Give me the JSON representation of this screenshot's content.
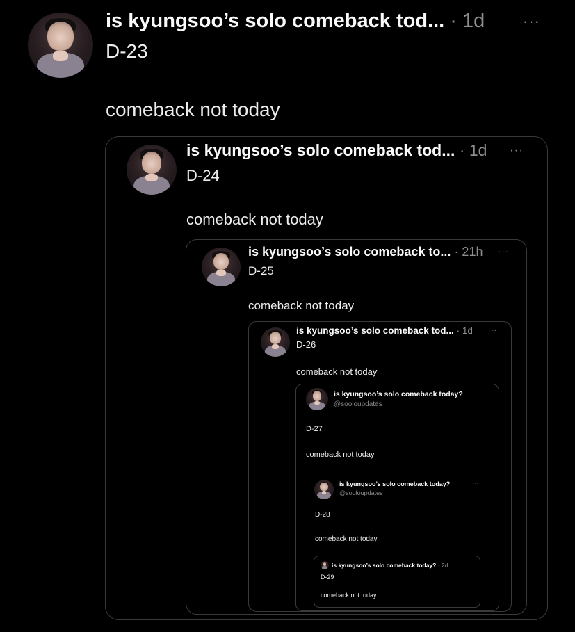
{
  "posts": [
    {
      "title": "is kyungsoo’s solo comeback tod...",
      "time": "· 1d",
      "dday": "D-23",
      "body": "comeback not today"
    },
    {
      "title": "is kyungsoo’s solo comeback tod...",
      "time": "· 1d",
      "dday": "D-24",
      "body": "comeback not today"
    },
    {
      "title": "is kyungsoo’s solo comeback to...",
      "time": "· 21h",
      "dday": "D-25",
      "body": "comeback not today"
    },
    {
      "title": "is kyungsoo’s solo comeback tod...",
      "time": "· 1d",
      "dday": "D-26",
      "body": "comeback not today"
    },
    {
      "title": "is kyungsoo’s solo comeback today?",
      "handle": "@sooloupdates",
      "dday": "D-27",
      "body": "comeback not today"
    },
    {
      "title": "is kyungsoo’s solo comeback today?",
      "handle": "@sooloupdates",
      "dday": "D-28",
      "body": "comeback not today"
    },
    {
      "title": "is kyungsoo’s solo comeback today?",
      "time": "· 2d",
      "dday": "D-29",
      "body": "comeback not today"
    }
  ],
  "more_label": "···",
  "colors": {
    "background": "#000000",
    "border": "#3a3a3a",
    "muted": "#8e8e8e",
    "text": "#ededed"
  },
  "icons": {
    "avatar": "profile-photo",
    "more": "more-options-icon"
  }
}
